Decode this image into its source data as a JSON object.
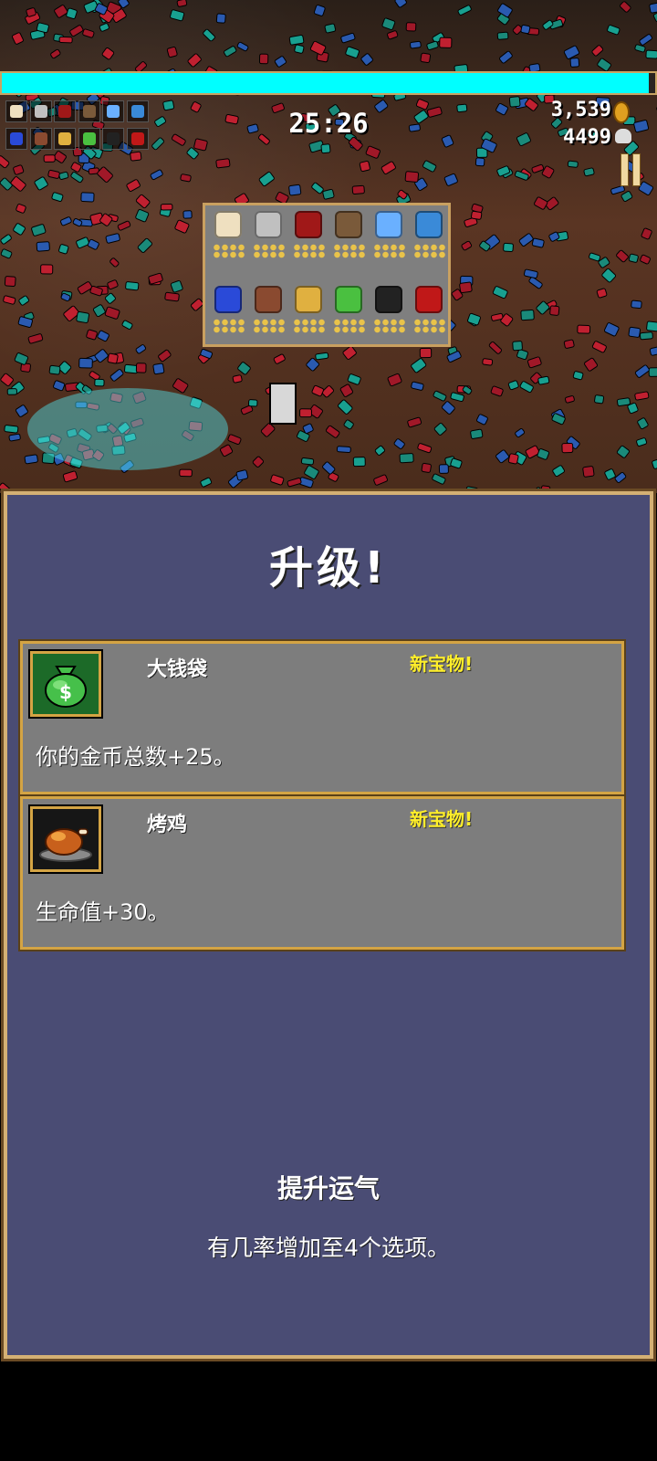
{
  "hud": {
    "timer": "25:26",
    "gold": "3,539",
    "kills": "4499",
    "xp_fraction": 0.99
  },
  "weapon_slots": [
    "garlic-icon",
    "whip-icon",
    "bible-icon",
    "fire-wand-icon",
    "holy-water-icon",
    "magic-wand-icon"
  ],
  "passive_slots": [
    "orb-icon",
    "armor-icon",
    "candelabrador-icon",
    "feather-icon",
    "heart-icon",
    "tome-icon"
  ],
  "colors": {
    "xp_bar": "#00ffff",
    "dialog_bg": "#4a4c74",
    "card_bg": "#7d7d7d",
    "gold_border": "#d4a444",
    "badge_yellow": "#ffef2a"
  },
  "levelup": {
    "title": "升级!",
    "options": [
      {
        "name": "大钱袋",
        "badge": "新宝物!",
        "description": "你的金币总数+25。",
        "icon": "money-bag-icon"
      },
      {
        "name": "烤鸡",
        "badge": "新宝物!",
        "description": "生命值+30。",
        "icon": "roast-chicken-icon"
      }
    ],
    "luck_title": "提升运气",
    "luck_desc": "有几率增加至4个选项。"
  }
}
